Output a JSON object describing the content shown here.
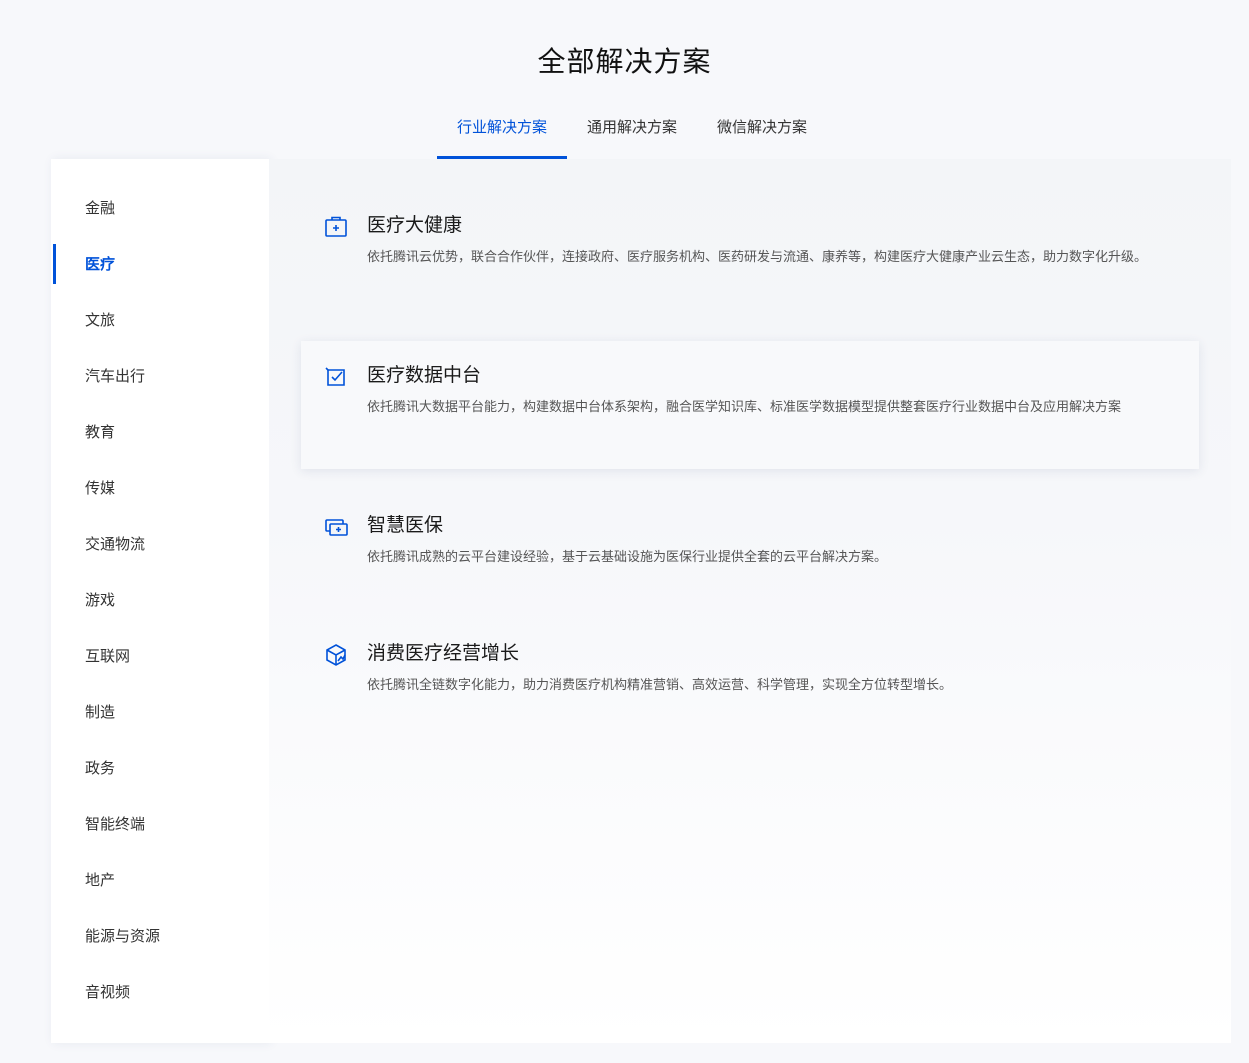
{
  "page": {
    "title": "全部解决方案"
  },
  "tabs": [
    {
      "label": "行业解决方案"
    },
    {
      "label": "通用解决方案"
    },
    {
      "label": "微信解决方案"
    }
  ],
  "sidebar": {
    "items": [
      {
        "label": "金融"
      },
      {
        "label": "医疗"
      },
      {
        "label": "文旅"
      },
      {
        "label": "汽车出行"
      },
      {
        "label": "教育"
      },
      {
        "label": "传媒"
      },
      {
        "label": "交通物流"
      },
      {
        "label": "游戏"
      },
      {
        "label": "互联网"
      },
      {
        "label": "制造"
      },
      {
        "label": "政务"
      },
      {
        "label": "智能终端"
      },
      {
        "label": "地产"
      },
      {
        "label": "能源与资源"
      },
      {
        "label": "音视频"
      }
    ]
  },
  "solutions": [
    {
      "icon": "medical-kit-icon",
      "title": "医疗大健康",
      "desc": "依托腾讯云优势，联合合作伙伴，连接政府、医疗服务机构、医药研发与流通、康养等，构建医疗大健康产业云生态，助力数字化升级。"
    },
    {
      "icon": "data-check-icon",
      "title": "医疗数据中台",
      "desc": "依托腾讯大数据平台能力，构建数据中台体系架构，融合医学知识库、标准医学数据模型提供整套医疗行业数据中台及应用解决方案"
    },
    {
      "icon": "insurance-card-icon",
      "title": "智慧医保",
      "desc": "依托腾讯成熟的云平台建设经验，基于云基础设施为医保行业提供全套的云平台解决方案。"
    },
    {
      "icon": "growth-box-icon",
      "title": "消费医疗经营增长",
      "desc": "依托腾讯全链数字化能力，助力消费医疗机构精准营销、高效运营、科学管理，实现全方位转型增长。"
    }
  ],
  "colors": {
    "accent": "#0052d9",
    "text": "#1a1a1a",
    "muted": "#555555"
  }
}
